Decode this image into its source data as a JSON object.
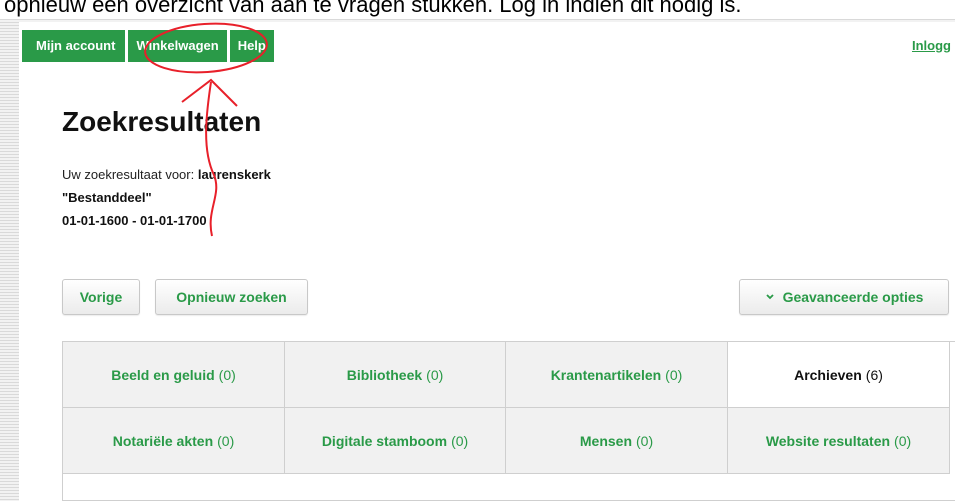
{
  "caption": "opnieuw een overzicht van aan te vragen stukken. Log in indien dit nodig is.",
  "nav": {
    "items": [
      "Mijn account",
      "Winkelwagen",
      "Help"
    ],
    "login": "Inlogg"
  },
  "colors": {
    "accent": "#2a9a48",
    "annotation": "#e8202a"
  },
  "page": {
    "title": "Zoekresultaten",
    "result_prefix": "Uw zoekresultaat voor: ",
    "query": "laurenskerk",
    "type": "\"Bestanddeel\"",
    "date_range": "01-01-1600 - 01-01-1700"
  },
  "buttons": {
    "previous": "Vorige",
    "new_search": "Opnieuw zoeken",
    "advanced": "Geavanceerde opties",
    "advanced_icon": "chevron-down-icon"
  },
  "categories": [
    {
      "name": "Beeld en geluid",
      "count": "(0)"
    },
    {
      "name": "Bibliotheek",
      "count": "(0)"
    },
    {
      "name": "Krantenartikelen",
      "count": "(0)"
    },
    {
      "name": "Archieven",
      "count": "(6)",
      "active": true
    },
    {
      "name": "Notariële akten",
      "count": "(0)"
    },
    {
      "name": "Digitale stamboom",
      "count": "(0)"
    },
    {
      "name": "Mensen",
      "count": "(0)"
    },
    {
      "name": "Website resultaten",
      "count": "(0)"
    }
  ]
}
